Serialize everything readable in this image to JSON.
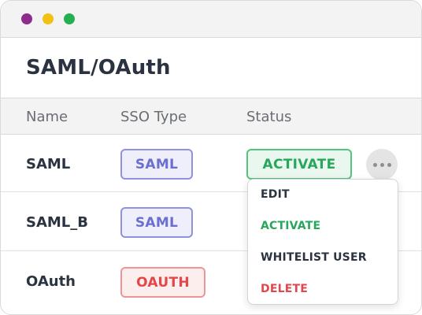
{
  "window": {
    "controls": [
      "close",
      "minimize",
      "maximize"
    ],
    "colors": {
      "close": "#8f2b8c",
      "minimize": "#f3c014",
      "maximize": "#24b04e"
    }
  },
  "page": {
    "title": "SAML/OAuth"
  },
  "table": {
    "headers": [
      "Name",
      "SSO Type",
      "Status"
    ],
    "rows": [
      {
        "name": "SAML",
        "sso_type": "SAML",
        "status": "ACTIVATE"
      },
      {
        "name": "SAML_B",
        "sso_type": "SAML"
      },
      {
        "name": "OAuth",
        "sso_type": "OAUTH"
      }
    ]
  },
  "context_menu": {
    "items": [
      "EDIT",
      "ACTIVATE",
      "WHITELIST USER",
      "DELETE"
    ],
    "colors": {
      "default": "#2b3340",
      "activate": "#27a75b",
      "delete": "#e2474c"
    }
  },
  "colors": {
    "saml_badge": "#6b6fcf",
    "oauth_badge": "#e2474c",
    "status_active": "#27a75b"
  },
  "icons": {
    "more": "more-horizontal-icon"
  }
}
